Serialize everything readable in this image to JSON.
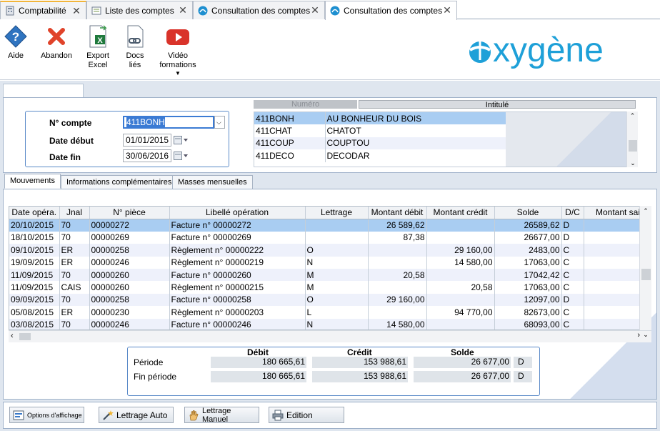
{
  "tabs": [
    {
      "label": "Comptabilité",
      "icon": "calculator-icon",
      "active": false
    },
    {
      "label": "Liste des comptes",
      "icon": "list-icon",
      "active": false
    },
    {
      "label": "Consultation des comptes",
      "icon": "oxygene-icon",
      "active": false
    },
    {
      "label": "Consultation des comptes",
      "icon": "oxygene-icon",
      "active": true
    }
  ],
  "toolbar": {
    "aide": "Aide",
    "abandon": "Abandon",
    "export_excel_1": "Export",
    "export_excel_2": "Excel",
    "docs_lies_1": "Docs",
    "docs_lies_2": "liés",
    "video_1": "Vidéo",
    "video_2": "formations"
  },
  "logo": {
    "text": "oxygène",
    "color": "#1ea0d8"
  },
  "form": {
    "compte_label": "N° compte",
    "compte_value": "411BONH",
    "date_debut_label": "Date début",
    "date_debut_value": "01/01/2015",
    "date_fin_label": "Date fin",
    "date_fin_value": "30/06/2016"
  },
  "accounts": {
    "headers": [
      "Numéro",
      "Intitulé"
    ],
    "rows": [
      [
        "411BONH",
        "AU BONHEUR DU BOIS"
      ],
      [
        "411CHAT",
        "CHATOT"
      ],
      [
        "411COUP",
        "COUPTOU"
      ],
      [
        "411DECO",
        "DECODAR"
      ]
    ]
  },
  "subtabs": [
    "Mouvements",
    "Informations complémentaires",
    "Masses mensuelles"
  ],
  "movements": {
    "headers": [
      "Date opéra.",
      "Jnal",
      "N° pièce",
      "Libellé opération",
      "Lettrage",
      "Montant débit",
      "Montant crédit",
      "Solde",
      "D/C",
      "Montant sai"
    ],
    "rows": [
      [
        "20/10/2015",
        "70",
        "00000272",
        "Facture n° 00000272",
        "",
        "26 589,62",
        "",
        "26589,62",
        "D",
        ""
      ],
      [
        "18/10/2015",
        "70",
        "00000269",
        "Facture n° 00000269",
        "",
        "87,38",
        "",
        "26677,00",
        "D",
        ""
      ],
      [
        "09/10/2015",
        "ER",
        "00000258",
        "Règlement n° 00000222",
        "O",
        "",
        "29 160,00",
        "2483,00",
        "C",
        ""
      ],
      [
        "19/09/2015",
        "ER",
        "00000246",
        "Règlement n° 00000219",
        "N",
        "",
        "14 580,00",
        "17063,00",
        "C",
        ""
      ],
      [
        "11/09/2015",
        "70",
        "00000260",
        "Facture n° 00000260",
        "M",
        "20,58",
        "",
        "17042,42",
        "C",
        ""
      ],
      [
        "11/09/2015",
        "CAIS",
        "00000260",
        "Règlement n° 00000215",
        "M",
        "",
        "20,58",
        "17063,00",
        "C",
        ""
      ],
      [
        "09/09/2015",
        "70",
        "00000258",
        "Facture n° 00000258",
        "O",
        "29 160,00",
        "",
        "12097,00",
        "D",
        ""
      ],
      [
        "05/08/2015",
        "ER",
        "00000230",
        "Règlement n° 00000203",
        "L",
        "",
        "94 770,00",
        "82673,00",
        "C",
        ""
      ],
      [
        "03/08/2015",
        "70",
        "00000246",
        "Facture n° 00000246",
        "N",
        "14 580,00",
        "",
        "68093,00",
        "C",
        ""
      ]
    ]
  },
  "totals": {
    "headers": [
      "Débit",
      "Crédit",
      "Solde"
    ],
    "rows": [
      {
        "label": "Période",
        "debit": "180 665,61",
        "credit": "153 988,61",
        "solde": "26 677,00",
        "dc": "D"
      },
      {
        "label": "Fin période",
        "debit": "180 665,61",
        "credit": "153 988,61",
        "solde": "26 677,00",
        "dc": "D"
      }
    ]
  },
  "buttons": {
    "options": "Options d'affichage",
    "lettrage_auto": "Lettrage Auto",
    "lettrage_manuel": "Lettrage Manuel",
    "edition": "Edition"
  }
}
